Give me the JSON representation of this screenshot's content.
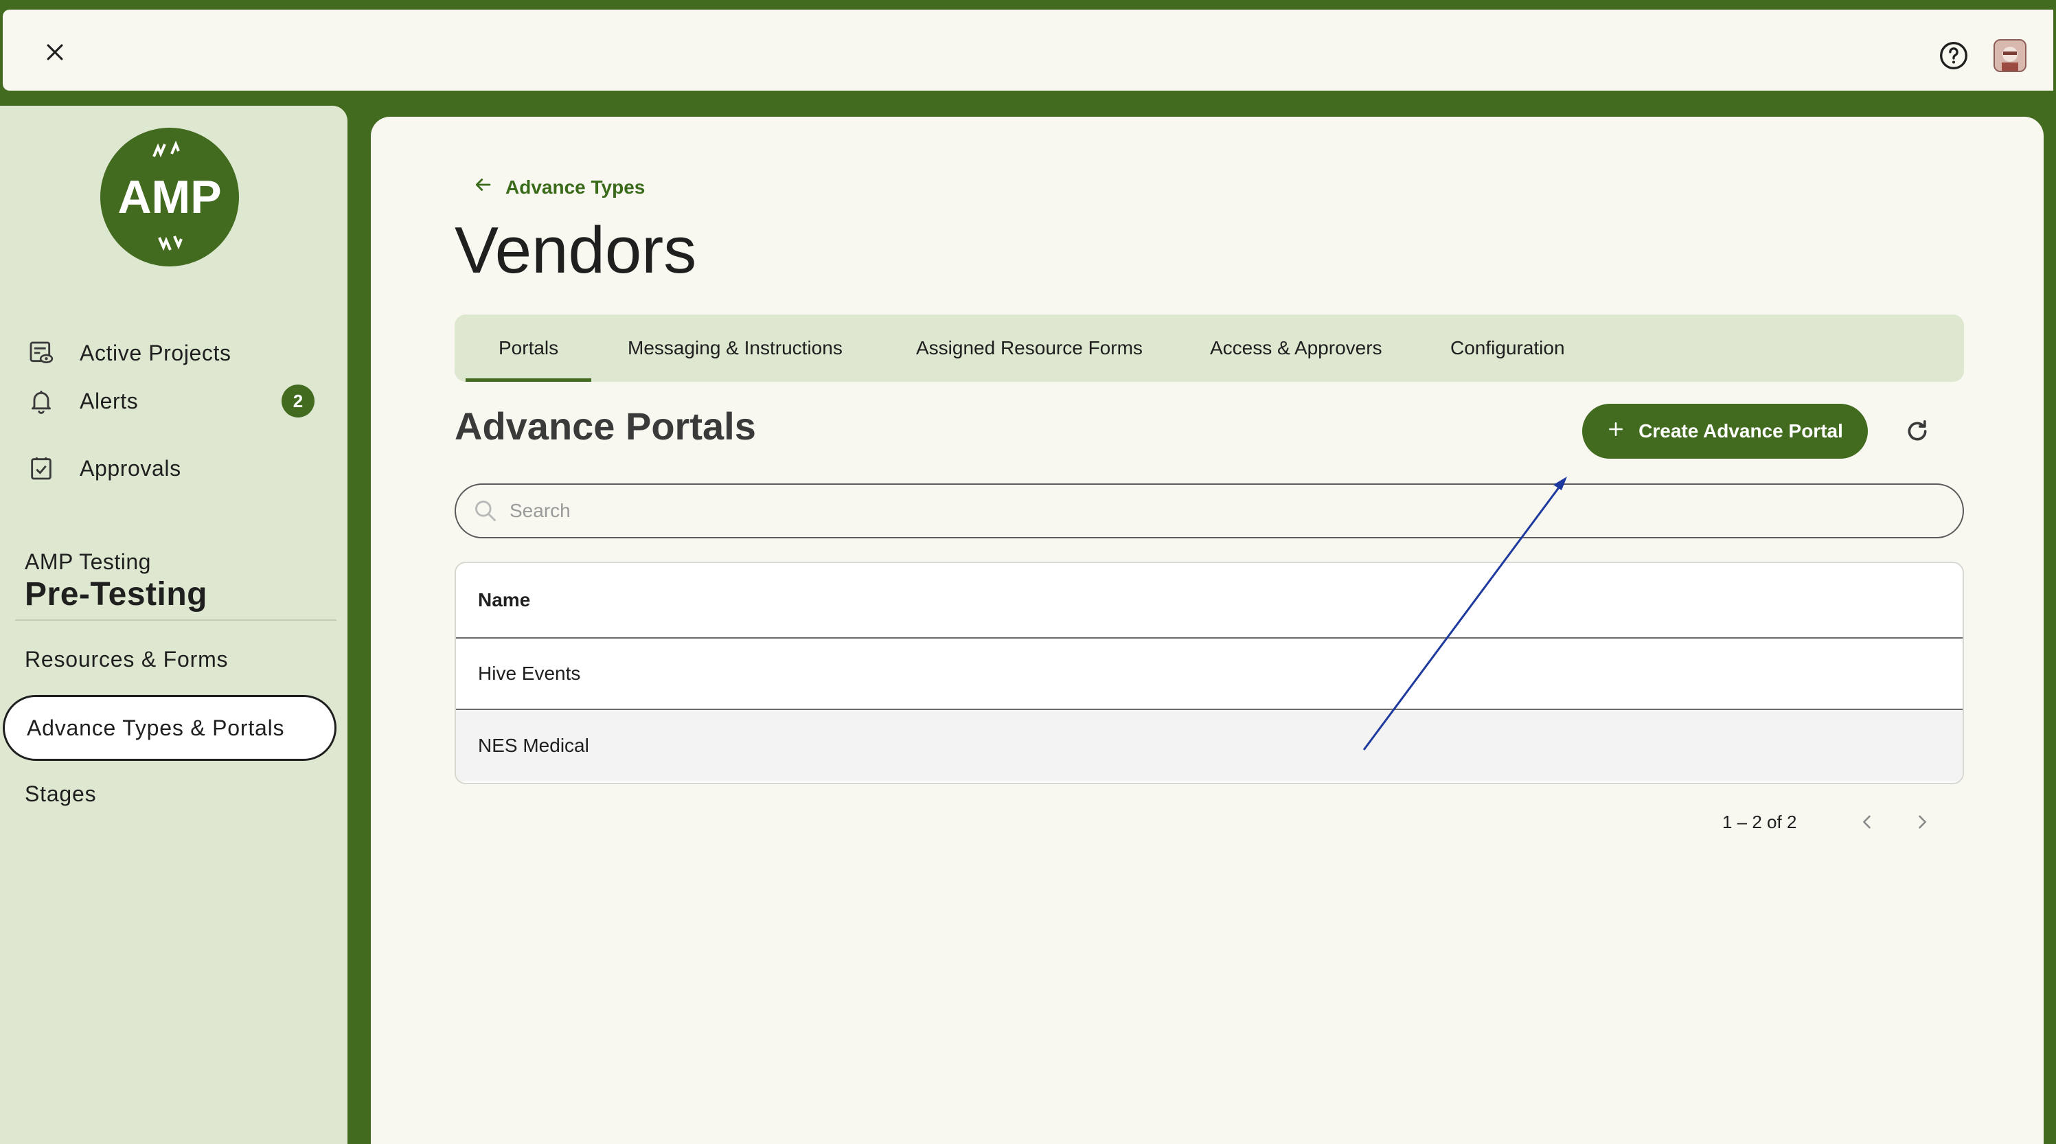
{
  "topbar": {
    "close_icon": "close-icon",
    "help_icon": "help-circle-icon",
    "avatar_icon": "user-avatar"
  },
  "sidebar": {
    "logo_text": "AMP",
    "nav": [
      {
        "label": "Active Projects",
        "icon": "projects-icon"
      },
      {
        "label": "Alerts",
        "icon": "bell-icon",
        "badge": "2"
      },
      {
        "label": "Approvals",
        "icon": "clipboard-check-icon"
      }
    ],
    "org_label": "AMP Testing",
    "org_title": "Pre-Testing",
    "sub_items": [
      {
        "label": "Resources & Forms"
      },
      {
        "label": "Advance Types & Portals",
        "active": true
      },
      {
        "label": "Stages"
      }
    ]
  },
  "main": {
    "back_label": "Advance Types",
    "page_title": "Vendors",
    "tabs": [
      {
        "label": "Portals",
        "active": true
      },
      {
        "label": "Messaging & Instructions"
      },
      {
        "label": "Assigned Resource Forms"
      },
      {
        "label": "Access & Approvers"
      },
      {
        "label": "Configuration"
      }
    ],
    "section_title": "Advance Portals",
    "create_label": "Create Advance Portal",
    "search_placeholder": "Search",
    "table": {
      "header": "Name",
      "rows": [
        "Hive Events",
        "NES Medical"
      ]
    },
    "pager": "1 – 2 of 2"
  },
  "colors": {
    "brand_green": "#426b1f",
    "sidebar_bg": "#dee7d0",
    "panel_bg": "#f8f8f1",
    "annotation_arrow": "#1f3a9e"
  }
}
